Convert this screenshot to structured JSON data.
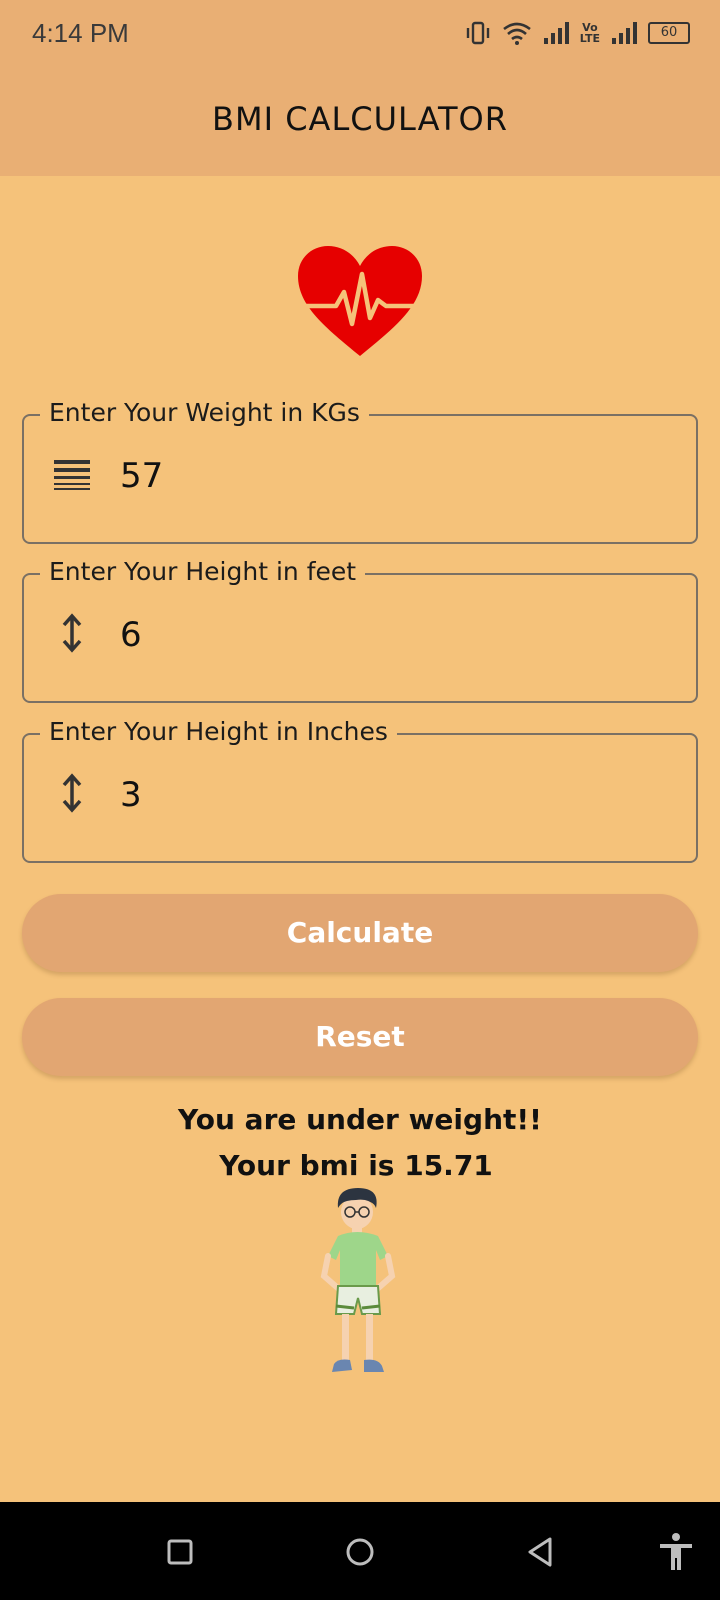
{
  "status_bar": {
    "time": "4:14 PM",
    "battery": "60",
    "network": "LTE"
  },
  "app_bar": {
    "title": "BMI CALCULATOR"
  },
  "form": {
    "weight": {
      "label": "Enter Your Weight in KGs",
      "value": "57",
      "icon": "scale-lines-icon"
    },
    "height_feet": {
      "label": "Enter Your Height in feet",
      "value": "6",
      "icon": "vertical-arrows-icon"
    },
    "height_inches": {
      "label": "Enter Your Height in Inches",
      "value": "3",
      "icon": "vertical-arrows-icon"
    }
  },
  "buttons": {
    "calculate": "Calculate",
    "reset": "Reset"
  },
  "result": {
    "message": "You are under weight!!",
    "bmi_text": "Your bmi is 15.71"
  },
  "nav": {
    "icons": [
      "recent-apps-icon",
      "home-icon",
      "back-icon",
      "accessibility-icon"
    ]
  },
  "colors": {
    "background": "#F5C27A",
    "app_bar": "#E9AF74",
    "button": "#E2A672",
    "heart": "#E60000"
  }
}
